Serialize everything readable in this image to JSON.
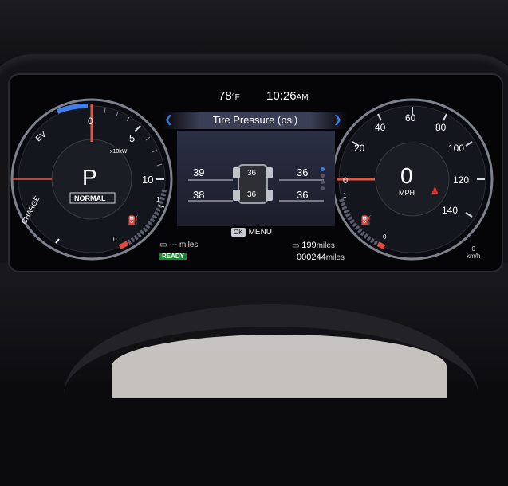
{
  "header": {
    "temperature": "78",
    "temperature_unit": "°F",
    "time": "10:26",
    "time_suffix": "AM"
  },
  "screen": {
    "title": "Tire Pressure (psi)",
    "ok_label": "OK",
    "menu_label": "MENU"
  },
  "tires": {
    "front_left": "39",
    "front_right": "36",
    "rear_left": "38",
    "rear_right": "36",
    "truck_front": "36",
    "truck_rear": "36"
  },
  "power_gauge": {
    "labels": {
      "ev": "EV",
      "charge": "CHARGE",
      "unit": "x10kW"
    },
    "ticks": [
      "0",
      "5",
      "10"
    ],
    "gear": "P",
    "mode": "NORMAL",
    "fuel_marks": [
      "1",
      "0"
    ],
    "needle_value": 0
  },
  "speed_gauge": {
    "ticks": [
      "0",
      "20",
      "40",
      "60",
      "80",
      "100",
      "120",
      "140"
    ],
    "speed": "0",
    "unit": "MPH",
    "kmh": "km/h",
    "kmh_value": "0",
    "fuel_marks": [
      "1",
      "0"
    ],
    "needle_value": 0
  },
  "trip": {
    "ev_range": "---",
    "ev_range_unit": "miles",
    "status": "READY",
    "range": "199",
    "range_unit": "miles",
    "odometer": "000244",
    "odometer_unit": "miles"
  },
  "colors": {
    "accent_blue": "#3f7fe8",
    "needle": "#e2553e",
    "ready_green": "#1a8a2e"
  }
}
